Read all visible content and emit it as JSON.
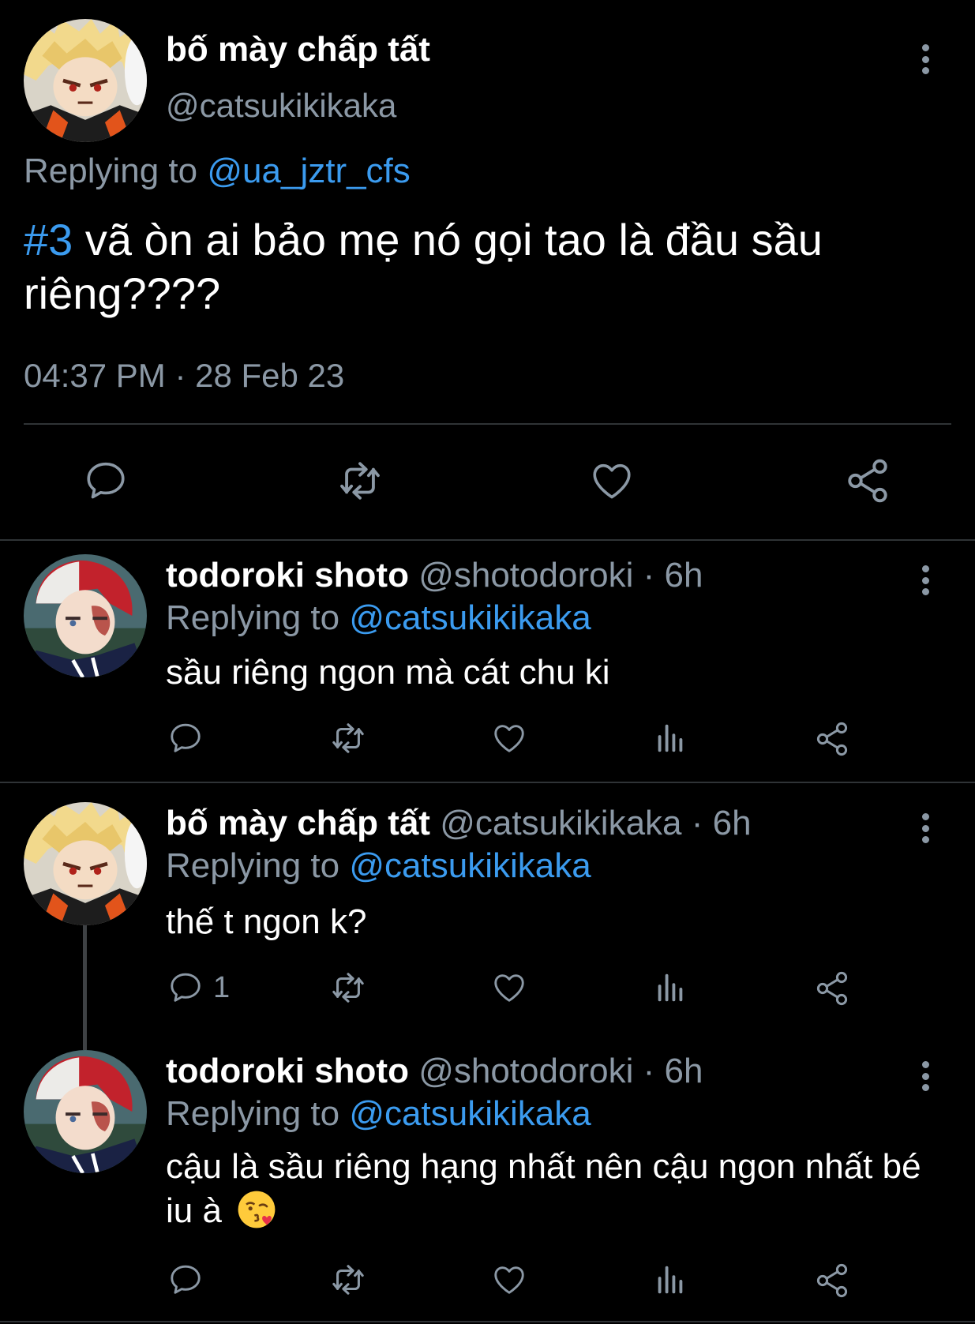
{
  "main": {
    "name": "bố mày chấp tất",
    "handle": "@catsukikikaka",
    "replying_prefix": "Replying to ",
    "replying_to": "@ua_jztr_cfs",
    "hashtag": "#3",
    "text": " vã òn ai bảo mẹ nó gọi tao là đầu sầu riêng????",
    "timestamp": "04:37 PM · 28 Feb 23"
  },
  "replies": [
    {
      "name": "todoroki shoto",
      "handle": "@shotodoroki",
      "time": "· 6h",
      "replying_prefix": "Replying to ",
      "replying_to": "@catsukikikaka",
      "text": "sầu riêng ngon mà cát chu ki",
      "reply_count": ""
    },
    {
      "name": "bố mày chấp tất",
      "handle": "@catsukikikaka",
      "time": "· 6h",
      "replying_prefix": "Replying to ",
      "replying_to": "@catsukikikaka",
      "text": "thế t ngon k?",
      "reply_count": "1"
    },
    {
      "name": "todoroki shoto",
      "handle": "@shotodoroki",
      "time": "· 6h",
      "replying_prefix": "Replying to ",
      "replying_to": "@catsukikikaka",
      "text": "cậu là sầu riêng hạng nhất nên cậu ngon nhất bé iu à",
      "emoji": "kissing-face-emoji",
      "reply_count": ""
    }
  ],
  "colors": {
    "background": "#000000",
    "text": "#ffffff",
    "muted": "#8b98a5",
    "link": "#3b9bef",
    "divider": "#2f3336"
  },
  "icons": [
    "comment-icon",
    "retweet-icon",
    "like-icon",
    "views-icon",
    "share-icon",
    "more-icon"
  ]
}
